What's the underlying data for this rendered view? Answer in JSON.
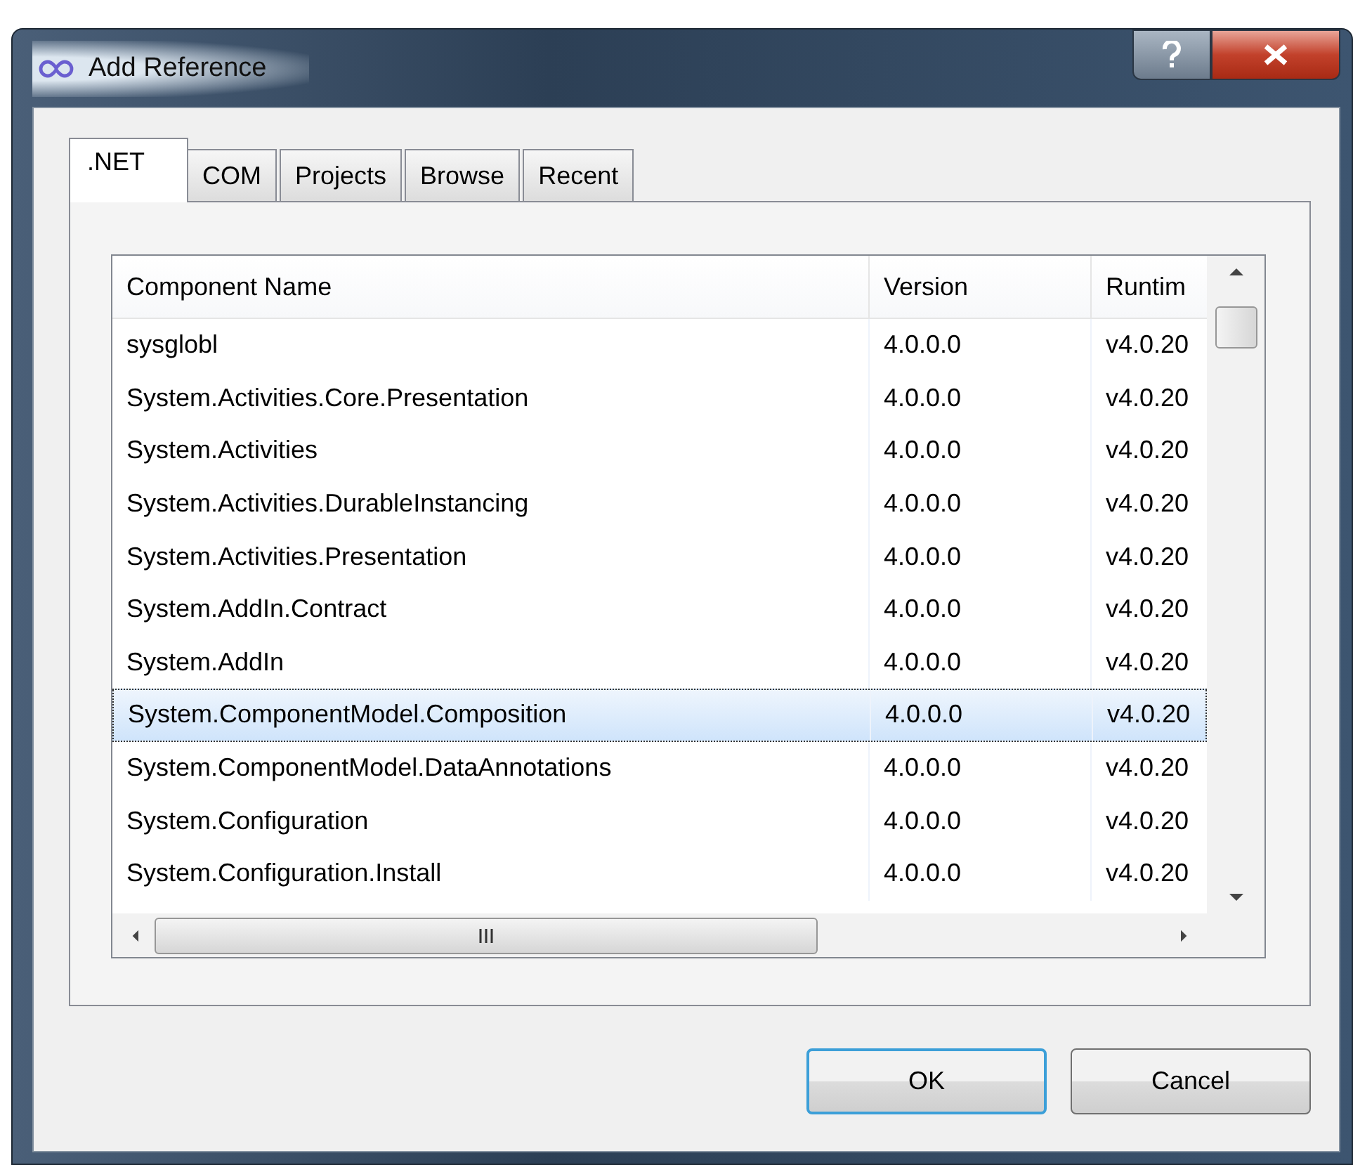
{
  "window": {
    "title": "Add Reference"
  },
  "tabs": [
    {
      "label": ".NET",
      "selected": true
    },
    {
      "label": "COM",
      "selected": false
    },
    {
      "label": "Projects",
      "selected": false
    },
    {
      "label": "Browse",
      "selected": false
    },
    {
      "label": "Recent",
      "selected": false
    }
  ],
  "table": {
    "columns": [
      "Component Name",
      "Version",
      "Runtim"
    ],
    "rows": [
      {
        "cells": [
          "sysglobl",
          "4.0.0.0",
          "v4.0.20"
        ],
        "selected": false
      },
      {
        "cells": [
          "System.Activities.Core.Presentation",
          "4.0.0.0",
          "v4.0.20"
        ],
        "selected": false
      },
      {
        "cells": [
          "System.Activities",
          "4.0.0.0",
          "v4.0.20"
        ],
        "selected": false
      },
      {
        "cells": [
          "System.Activities.DurableInstancing",
          "4.0.0.0",
          "v4.0.20"
        ],
        "selected": false
      },
      {
        "cells": [
          "System.Activities.Presentation",
          "4.0.0.0",
          "v4.0.20"
        ],
        "selected": false
      },
      {
        "cells": [
          "System.AddIn.Contract",
          "4.0.0.0",
          "v4.0.20"
        ],
        "selected": false
      },
      {
        "cells": [
          "System.AddIn",
          "4.0.0.0",
          "v4.0.20"
        ],
        "selected": false
      },
      {
        "cells": [
          "System.ComponentModel.Composition",
          "4.0.0.0",
          "v4.0.20"
        ],
        "selected": true
      },
      {
        "cells": [
          "System.ComponentModel.DataAnnotations",
          "4.0.0.0",
          "v4.0.20"
        ],
        "selected": false
      },
      {
        "cells": [
          "System.Configuration",
          "4.0.0.0",
          "v4.0.20"
        ],
        "selected": false
      },
      {
        "cells": [
          "System.Configuration.Install",
          "4.0.0.0",
          "v4.0.20"
        ],
        "selected": false
      }
    ]
  },
  "buttons": [
    {
      "label": "OK",
      "default": true
    },
    {
      "label": "Cancel",
      "default": false
    }
  ]
}
